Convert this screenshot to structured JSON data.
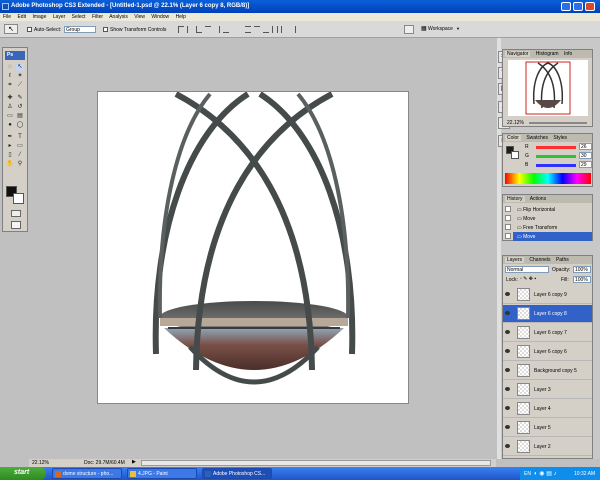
{
  "titlebar": {
    "title": "Adobe Photoshop CS3 Extended - [Untitled-1.psd @ 22.1% (Layer 6 copy 8, RGB/8)]"
  },
  "menu": [
    "File",
    "Edit",
    "Image",
    "Layer",
    "Select",
    "Filter",
    "Analysis",
    "View",
    "Window",
    "Help"
  ],
  "options": {
    "auto_select_label": "Auto-Select:",
    "auto_select_value": "Group",
    "transform_label": "Show Transform Controls",
    "workspace_label": "Workspace"
  },
  "toolbox": {
    "logo": "Ps"
  },
  "status": {
    "zoom": "22.12%",
    "doc": "Doc: 29.7M/60.4M"
  },
  "navigator": {
    "tabs": [
      "Navigator",
      "Histogram",
      "Info"
    ],
    "zoom": "22.12%"
  },
  "color": {
    "tabs": [
      "Color",
      "Swatches",
      "Styles"
    ],
    "channels": [
      {
        "label": "R",
        "value": "26",
        "track": "#ff3030"
      },
      {
        "label": "G",
        "value": "30",
        "track": "#30c030"
      },
      {
        "label": "B",
        "value": "29",
        "track": "#3030ff"
      }
    ]
  },
  "history": {
    "tabs": [
      "History",
      "Actions"
    ],
    "items": [
      "Flip Horizontal",
      "Move",
      "Free Transform",
      "Move"
    ],
    "active_index": 3
  },
  "layers": {
    "tabs": [
      "Layers",
      "Channels",
      "Paths"
    ],
    "mode": "Normal",
    "opacity_label": "Opacity:",
    "opacity": "100%",
    "lock_label": "Lock:",
    "fill_label": "Fill:",
    "fill": "100%",
    "rows": [
      {
        "name": "Layer 6 copy 9"
      },
      {
        "name": "Layer 6 copy 8"
      },
      {
        "name": "Layer 6 copy 7"
      },
      {
        "name": "Layer 6 copy 6"
      },
      {
        "name": "Background copy 5"
      },
      {
        "name": "Layer 3"
      },
      {
        "name": "Layer 4"
      },
      {
        "name": "Layer 5"
      },
      {
        "name": "Layer 2"
      }
    ],
    "active_index": 1
  },
  "taskbar": {
    "start": "start",
    "buttons": [
      "dome structure - pho...",
      "4.JPG - Paint",
      "Adobe Photoshop CS..."
    ],
    "lang": "EN",
    "clock": "10:32 AM"
  }
}
